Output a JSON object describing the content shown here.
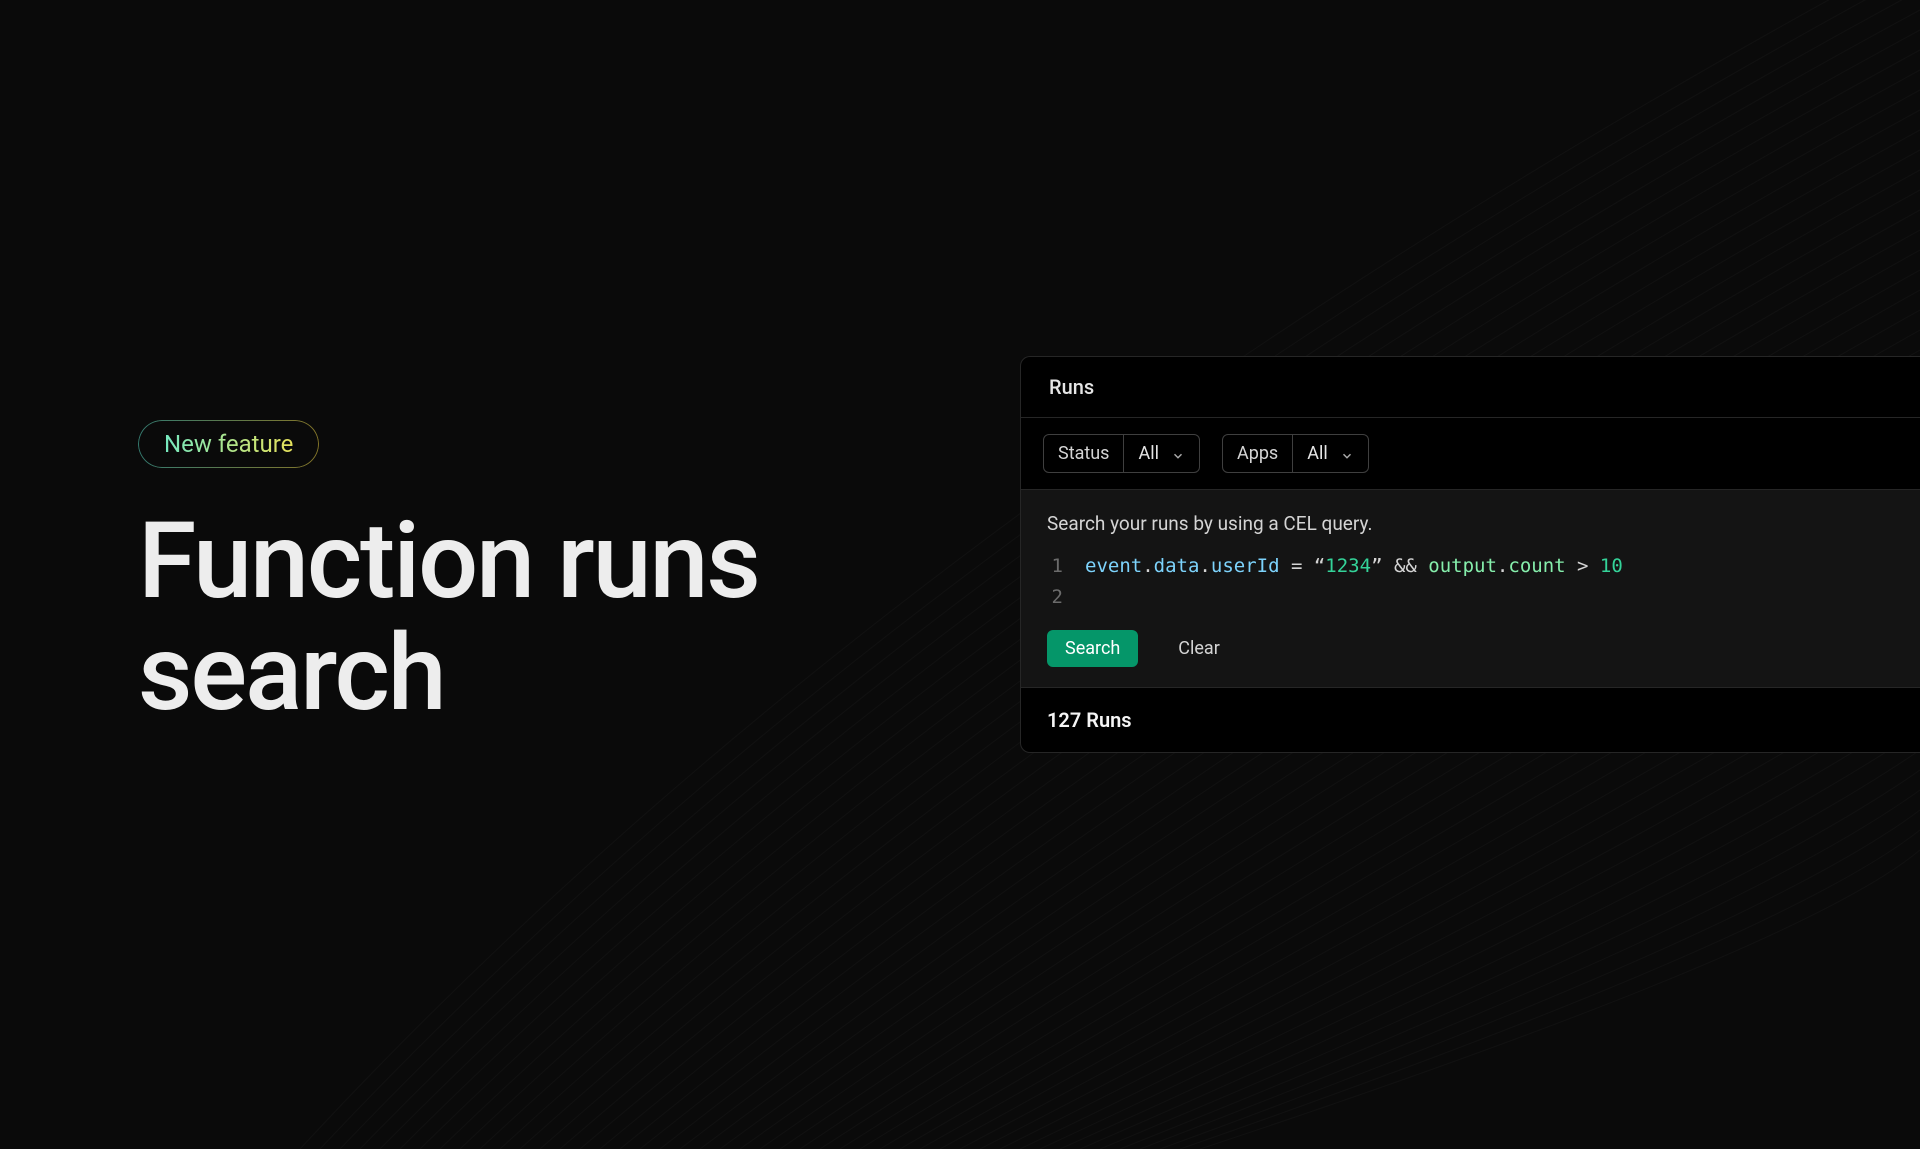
{
  "hero": {
    "badge": "New feature",
    "headline_line1": "Function runs",
    "headline_line2": "search"
  },
  "panel": {
    "title": "Runs",
    "filters": {
      "status": {
        "label": "Status",
        "value": "All"
      },
      "apps": {
        "label": "Apps",
        "value": "All"
      }
    },
    "search": {
      "hint": "Search your runs by using a CEL query.",
      "lines": [
        {
          "num": "1",
          "tokens": [
            {
              "t": "event",
              "c": "tok-prop"
            },
            {
              "t": ".",
              "c": "tok-op"
            },
            {
              "t": "data",
              "c": "tok-prop"
            },
            {
              "t": ".",
              "c": "tok-op"
            },
            {
              "t": "userId",
              "c": "tok-prop"
            },
            {
              "t": " = ",
              "c": "tok-op"
            },
            {
              "t": "“",
              "c": "tok-quote"
            },
            {
              "t": "1234",
              "c": "tok-str"
            },
            {
              "t": "”",
              "c": "tok-quote"
            },
            {
              "t": " && ",
              "c": "tok-op"
            },
            {
              "t": "output",
              "c": "tok-prop-alt"
            },
            {
              "t": ".",
              "c": "tok-op"
            },
            {
              "t": "count",
              "c": "tok-prop-alt"
            },
            {
              "t": " > ",
              "c": "tok-op"
            },
            {
              "t": "10",
              "c": "tok-num"
            }
          ]
        },
        {
          "num": "2",
          "tokens": []
        }
      ],
      "search_label": "Search",
      "clear_label": "Clear"
    },
    "results": {
      "count_label": "127 Runs"
    }
  }
}
